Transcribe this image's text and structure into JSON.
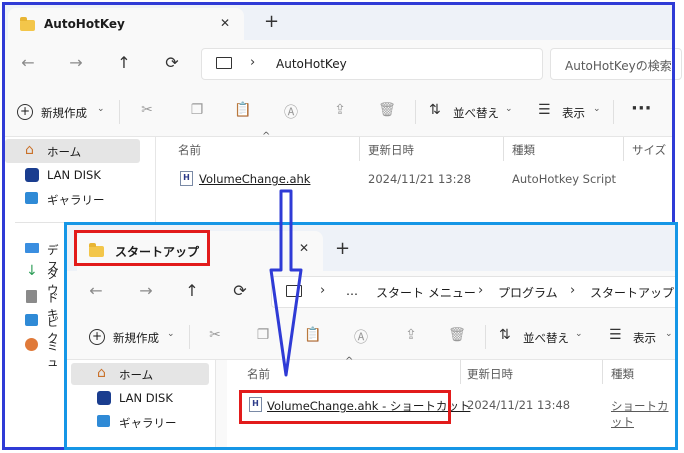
{
  "back": {
    "tab_title": "AutoHotKey",
    "close_glyph": "✕",
    "new_tab_glyph": "+",
    "nav": {
      "back": "←",
      "forward": "→",
      "up": "↑",
      "refresh": "⟳"
    },
    "breadcrumb": [
      "AutoHotKey"
    ],
    "search_placeholder": "AutoHotKeyの検索",
    "toolbar": {
      "new_label": "新規作成",
      "sort_label": "並べ替え",
      "view_label": "表示",
      "more": "···"
    },
    "sidebar": {
      "items": [
        {
          "icon": "home-icon",
          "label": "ホーム",
          "selected": true
        },
        {
          "icon": "nas-icon",
          "label": "LAN DISK"
        },
        {
          "icon": "gallery-icon",
          "label": "ギャラリー"
        },
        {
          "icon": "desktop-icon",
          "label": "デス"
        },
        {
          "icon": "download-icon",
          "label": "ダウ"
        },
        {
          "icon": "document-icon",
          "label": "ドキ"
        },
        {
          "icon": "picture-icon",
          "label": "ピク"
        },
        {
          "icon": "music-icon",
          "label": "ミュ"
        }
      ]
    },
    "columns": [
      "名前",
      "更新日時",
      "種類",
      "サイズ"
    ],
    "files": [
      {
        "name": "VolumeChange.ahk",
        "modified": "2024/11/21 13:28",
        "type": "AutoHotkey Script"
      }
    ]
  },
  "front": {
    "tab_title": "スタートアップ",
    "close_glyph": "✕",
    "new_tab_glyph": "+",
    "nav": {
      "back": "←",
      "forward": "→",
      "up": "↑",
      "refresh": "⟳"
    },
    "breadcrumb": [
      "…",
      "スタート メニュー",
      "プログラム",
      "スタートアップ"
    ],
    "toolbar": {
      "new_label": "新規作成",
      "sort_label": "並べ替え",
      "view_label": "表示"
    },
    "sidebar": {
      "items": [
        {
          "icon": "home-icon",
          "label": "ホーム",
          "selected": true
        },
        {
          "icon": "nas-icon",
          "label": "LAN DISK"
        },
        {
          "icon": "gallery-icon",
          "label": "ギャラリー"
        }
      ]
    },
    "columns": [
      "名前",
      "更新日時",
      "種類"
    ],
    "files": [
      {
        "name": "VolumeChange.ahk - ショートカット",
        "modified": "2024/11/21 13:48",
        "type": "ショートカット"
      }
    ]
  },
  "colors": {
    "back_frame": "#2f3bd6",
    "front_frame": "#1596e6",
    "highlight": "#e21b1b",
    "arrow": "#2f3bd6"
  }
}
